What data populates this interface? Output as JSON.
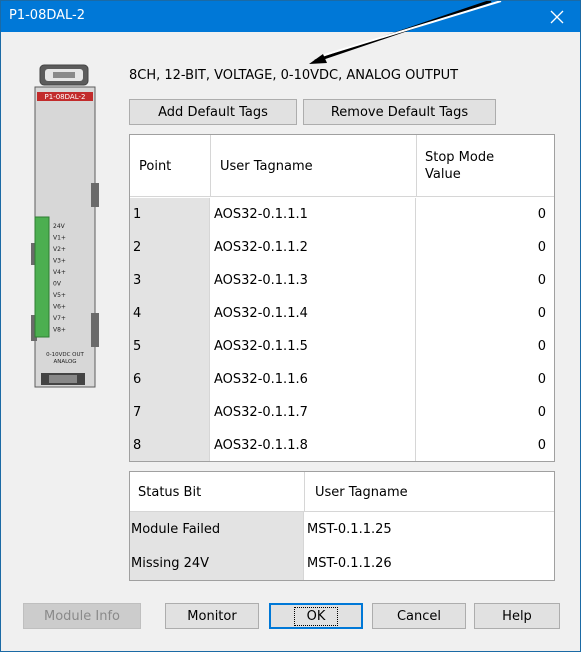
{
  "window": {
    "title": "P1-08DAL-2"
  },
  "module": {
    "description": "8CH, 12-BIT, VOLTAGE, 0-10VDC, ANALOG OUTPUT",
    "image_label": "P1-08DAL-2",
    "terminal_labels": [
      "24V",
      "V1+",
      "V2+",
      "V3+",
      "V4+",
      "0V",
      "V5+",
      "V6+",
      "V7+",
      "V8+"
    ],
    "footer_label_1": "0-10VDC OUT",
    "footer_label_2": "ANALOG"
  },
  "buttons": {
    "add_default_tags": "Add Default Tags",
    "remove_default_tags": "Remove Default Tags",
    "module_info": "Module Info",
    "monitor": "Monitor",
    "ok": "OK",
    "cancel": "Cancel",
    "help": "Help"
  },
  "points_table": {
    "headers": {
      "point": "Point",
      "user_tagname": "User Tagname",
      "stop_mode_line1": "Stop Mode",
      "stop_mode_line2": "Value"
    },
    "rows": [
      {
        "point": "1",
        "tag": "AOS32-0.1.1.1",
        "value": "0"
      },
      {
        "point": "2",
        "tag": "AOS32-0.1.1.2",
        "value": "0"
      },
      {
        "point": "3",
        "tag": "AOS32-0.1.1.3",
        "value": "0"
      },
      {
        "point": "4",
        "tag": "AOS32-0.1.1.4",
        "value": "0"
      },
      {
        "point": "5",
        "tag": "AOS32-0.1.1.5",
        "value": "0"
      },
      {
        "point": "6",
        "tag": "AOS32-0.1.1.6",
        "value": "0"
      },
      {
        "point": "7",
        "tag": "AOS32-0.1.1.7",
        "value": "0"
      },
      {
        "point": "8",
        "tag": "AOS32-0.1.1.8",
        "value": "0"
      }
    ]
  },
  "status_table": {
    "headers": {
      "status_bit": "Status Bit",
      "user_tagname": "User Tagname"
    },
    "rows": [
      {
        "status": "Module Failed",
        "tag": "MST-0.1.1.25"
      },
      {
        "status": "Missing 24V",
        "tag": "MST-0.1.1.26"
      }
    ]
  }
}
